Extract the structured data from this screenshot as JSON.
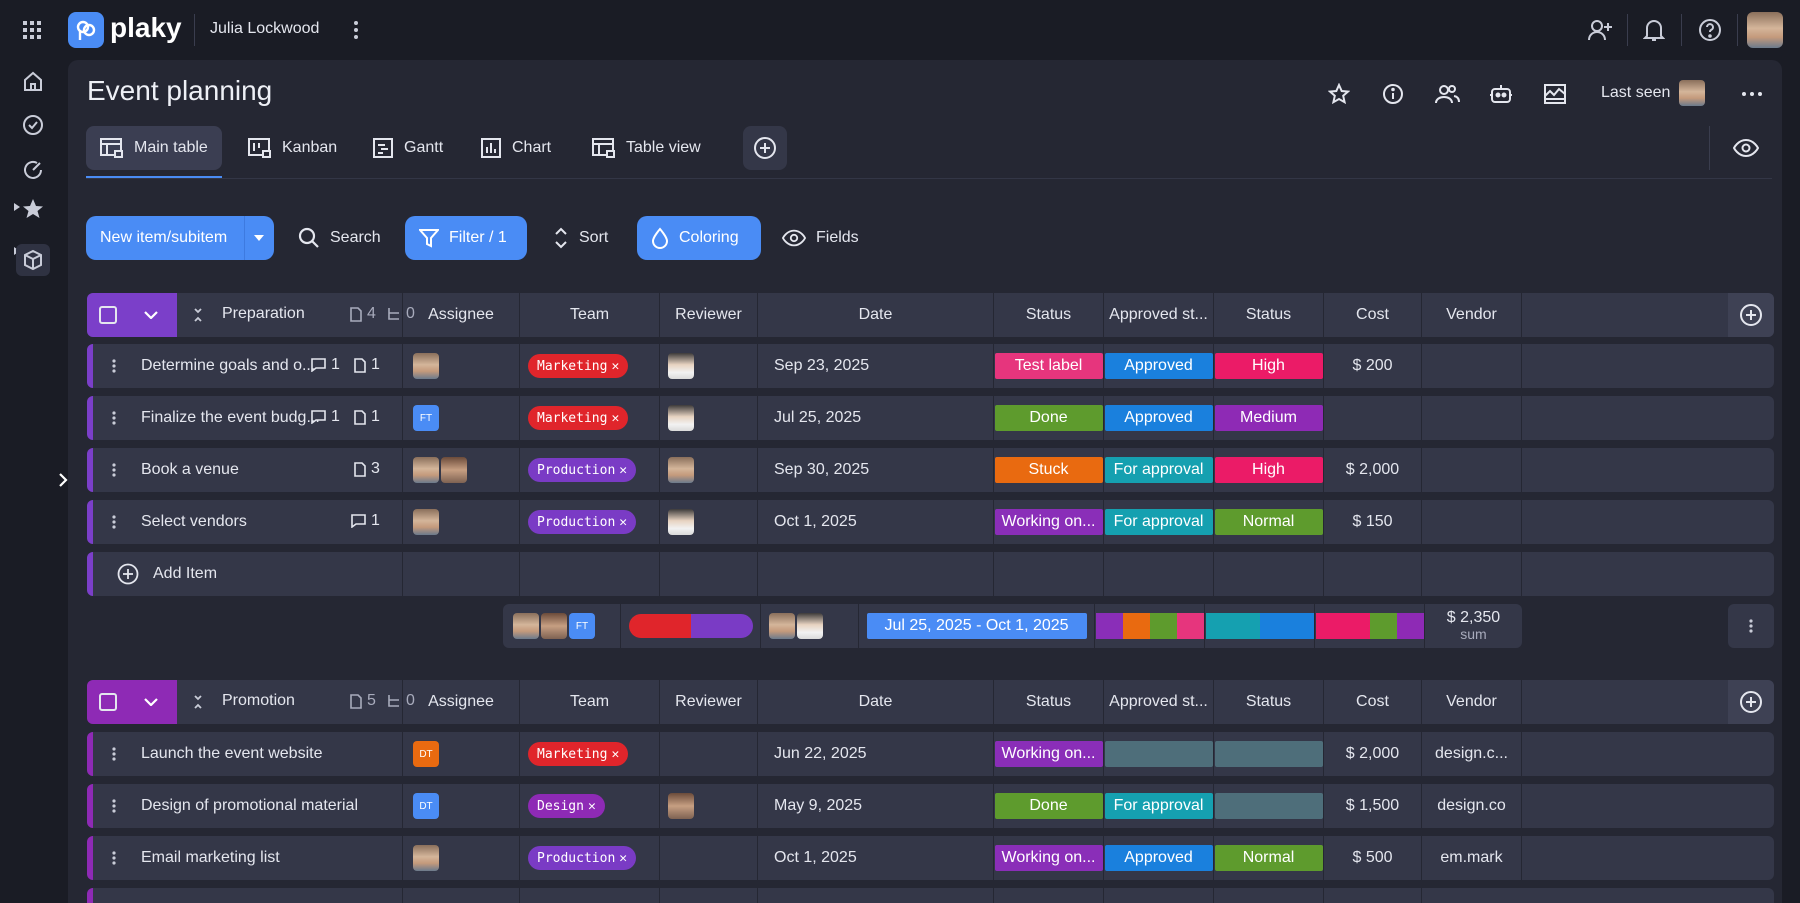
{
  "app": {
    "logo_text": "plaky",
    "user_name": "Julia Lockwood"
  },
  "board": {
    "title": "Event planning",
    "last_seen_label": "Last seen"
  },
  "views": [
    {
      "label": "Main table"
    },
    {
      "label": "Kanban"
    },
    {
      "label": "Gantt"
    },
    {
      "label": "Chart"
    },
    {
      "label": "Table view"
    }
  ],
  "toolbar": {
    "new_item": "New item/subitem",
    "search": "Search",
    "filter": "Filter / 1",
    "sort": "Sort",
    "coloring": "Coloring",
    "fields": "Fields"
  },
  "columns": [
    "Assignee",
    "Team",
    "Reviewer",
    "Date",
    "Status",
    "Approved st...",
    "Status",
    "Cost",
    "Vendor"
  ],
  "colors": {
    "accent": "#4a8cf5",
    "group_purple": "#7b3fc9",
    "status_test": "#e6357d",
    "status_done": "#5e9b2d",
    "status_stuck": "#e96a10",
    "status_working": "#8a2eb8",
    "approved": "#1a80dd",
    "for_approval": "#15a0b0",
    "priority_high": "#eb1b67",
    "priority_medium": "#8e2ab5",
    "priority_normal": "#5e9b2d",
    "empty": "#4e6e7a",
    "team_marketing": "#e0252b",
    "team_production": "#7a3bc5",
    "team_design": "#8e2ab5"
  },
  "groups": [
    {
      "name": "Preparation",
      "items_count": "4",
      "subitems_count": "0",
      "rows": [
        {
          "name": "Determine goals and o...",
          "comments": "1",
          "files": "1",
          "assignee": [
            "photo"
          ],
          "team": "Marketing",
          "reviewer": "photo2",
          "date": "Sep 23, 2025",
          "status": "Test label",
          "approved": "Approved",
          "priority": "High",
          "cost": "$ 200",
          "vendor": ""
        },
        {
          "name": "Finalize the event budg...",
          "comments": "1",
          "files": "1",
          "assignee": [
            "FT"
          ],
          "team": "Marketing",
          "reviewer": "photo2",
          "date": "Jul 25, 2025",
          "status": "Done",
          "approved": "Approved",
          "priority": "Medium",
          "cost": "",
          "vendor": ""
        },
        {
          "name": "Book a venue",
          "comments": "",
          "files": "3",
          "assignee": [
            "photo",
            "photo3"
          ],
          "team": "Production",
          "reviewer": "photo",
          "date": "Sep 30, 2025",
          "status": "Stuck",
          "approved": "For approval",
          "priority": "High",
          "cost": "$ 2,000",
          "vendor": ""
        },
        {
          "name": "Select vendors",
          "comments": "1",
          "files": "",
          "assignee": [
            "photo"
          ],
          "team": "Production",
          "reviewer": "photo2",
          "date": "Oct 1, 2025",
          "status": "Working on...",
          "approved": "For approval",
          "priority": "Normal",
          "cost": "$ 150",
          "vendor": ""
        }
      ],
      "add_item": "Add Item",
      "summary": {
        "assignee_ft": "FT",
        "date_range": "Jul 25, 2025 - Oct 1, 2025",
        "cost_sum": "$ 2,350",
        "cost_label": "sum"
      }
    },
    {
      "name": "Promotion",
      "items_count": "5",
      "subitems_count": "0",
      "rows": [
        {
          "name": "Launch the event website",
          "assignee": [
            "DT"
          ],
          "team": "Marketing",
          "reviewer": "",
          "date": "Jun 22, 2025",
          "status": "Working on...",
          "approved": "",
          "priority": "",
          "cost": "$ 2,000",
          "vendor": "design.c..."
        },
        {
          "name": "Design of promotional material",
          "assignee": [
            "DT"
          ],
          "team": "Design",
          "reviewer": "photo3",
          "date": "May 9, 2025",
          "status": "Done",
          "approved": "For approval",
          "priority": "",
          "cost": "$ 1,500",
          "vendor": "design.co"
        },
        {
          "name": "Email marketing list",
          "assignee": [
            "photo"
          ],
          "team": "Production",
          "reviewer": "",
          "date": "Oct 1, 2025",
          "status": "Working on...",
          "approved": "Approved",
          "priority": "Normal",
          "cost": "$ 500",
          "vendor": "em.mark"
        }
      ]
    }
  ]
}
